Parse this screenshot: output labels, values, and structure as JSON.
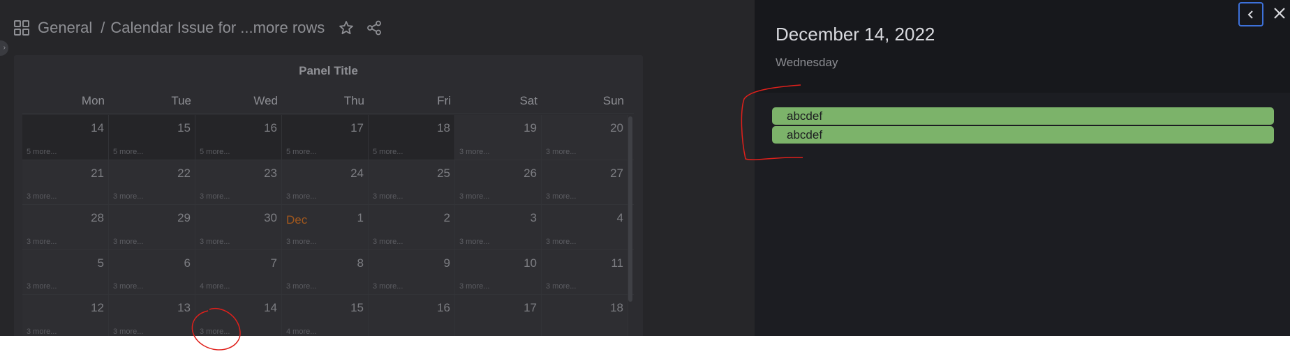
{
  "header": {
    "root": "General",
    "separator": "/",
    "title": "Calendar Issue for ...more rows"
  },
  "panel": {
    "title": "Panel Title",
    "weekdays": [
      "Mon",
      "Tue",
      "Wed",
      "Thu",
      "Fri",
      "Sat",
      "Sun"
    ],
    "weeks": [
      [
        {
          "day": "14",
          "more": "5 more...",
          "tone": "dark"
        },
        {
          "day": "15",
          "more": "5 more...",
          "tone": "dark"
        },
        {
          "day": "16",
          "more": "5 more...",
          "tone": "dark"
        },
        {
          "day": "17",
          "more": "5 more...",
          "tone": "dark"
        },
        {
          "day": "18",
          "more": "5 more...",
          "tone": "dark"
        },
        {
          "day": "19",
          "more": "3 more...",
          "tone": "weekend"
        },
        {
          "day": "20",
          "more": "3 more...",
          "tone": "weekend"
        }
      ],
      [
        {
          "day": "21",
          "more": "3 more...",
          "tone": "weekend"
        },
        {
          "day": "22",
          "more": "3 more...",
          "tone": "weekend"
        },
        {
          "day": "23",
          "more": "3 more...",
          "tone": "weekend"
        },
        {
          "day": "24",
          "more": "3 more...",
          "tone": "weekend"
        },
        {
          "day": "25",
          "more": "3 more...",
          "tone": "weekend"
        },
        {
          "day": "26",
          "more": "3 more...",
          "tone": "weekend"
        },
        {
          "day": "27",
          "more": "3 more...",
          "tone": "weekend"
        }
      ],
      [
        {
          "day": "28",
          "more": "3 more...",
          "tone": "weekend"
        },
        {
          "day": "29",
          "more": "3 more...",
          "tone": "weekend"
        },
        {
          "day": "30",
          "more": "3 more...",
          "tone": "weekend"
        },
        {
          "day": "1",
          "month": "Dec",
          "more": "3 more...",
          "tone": "weekend"
        },
        {
          "day": "2",
          "more": "3 more...",
          "tone": "weekend"
        },
        {
          "day": "3",
          "more": "3 more...",
          "tone": "weekend"
        },
        {
          "day": "4",
          "more": "3 more...",
          "tone": "weekend"
        }
      ],
      [
        {
          "day": "5",
          "more": "3 more...",
          "tone": "weekend"
        },
        {
          "day": "6",
          "more": "3 more...",
          "tone": "weekend"
        },
        {
          "day": "7",
          "more": "4 more...",
          "tone": "weekend"
        },
        {
          "day": "8",
          "more": "3 more...",
          "tone": "weekend"
        },
        {
          "day": "9",
          "more": "3 more...",
          "tone": "weekend"
        },
        {
          "day": "10",
          "more": "3 more...",
          "tone": "weekend"
        },
        {
          "day": "11",
          "more": "3 more...",
          "tone": "weekend"
        }
      ],
      [
        {
          "day": "12",
          "more": "3 more...",
          "tone": "weekend"
        },
        {
          "day": "13",
          "more": "3 more...",
          "tone": "weekend"
        },
        {
          "day": "14",
          "more": "3 more...",
          "tone": "weekend"
        },
        {
          "day": "15",
          "more": "4 more...",
          "tone": "weekend"
        },
        {
          "day": "16",
          "more": "",
          "tone": "weekend"
        },
        {
          "day": "17",
          "more": "",
          "tone": "weekend"
        },
        {
          "day": "18",
          "more": "",
          "tone": "weekend"
        }
      ]
    ]
  },
  "drawer": {
    "date": "December 14, 2022",
    "weekday": "Wednesday",
    "events": [
      "abcdef",
      "abcdef"
    ],
    "back_icon": "chevron-left-icon",
    "close_icon": "close-icon"
  },
  "colors": {
    "event": "#7cb36a",
    "month_label": "#a0571d",
    "focus_border": "#3d71d9",
    "annotation": "#e0201b"
  }
}
